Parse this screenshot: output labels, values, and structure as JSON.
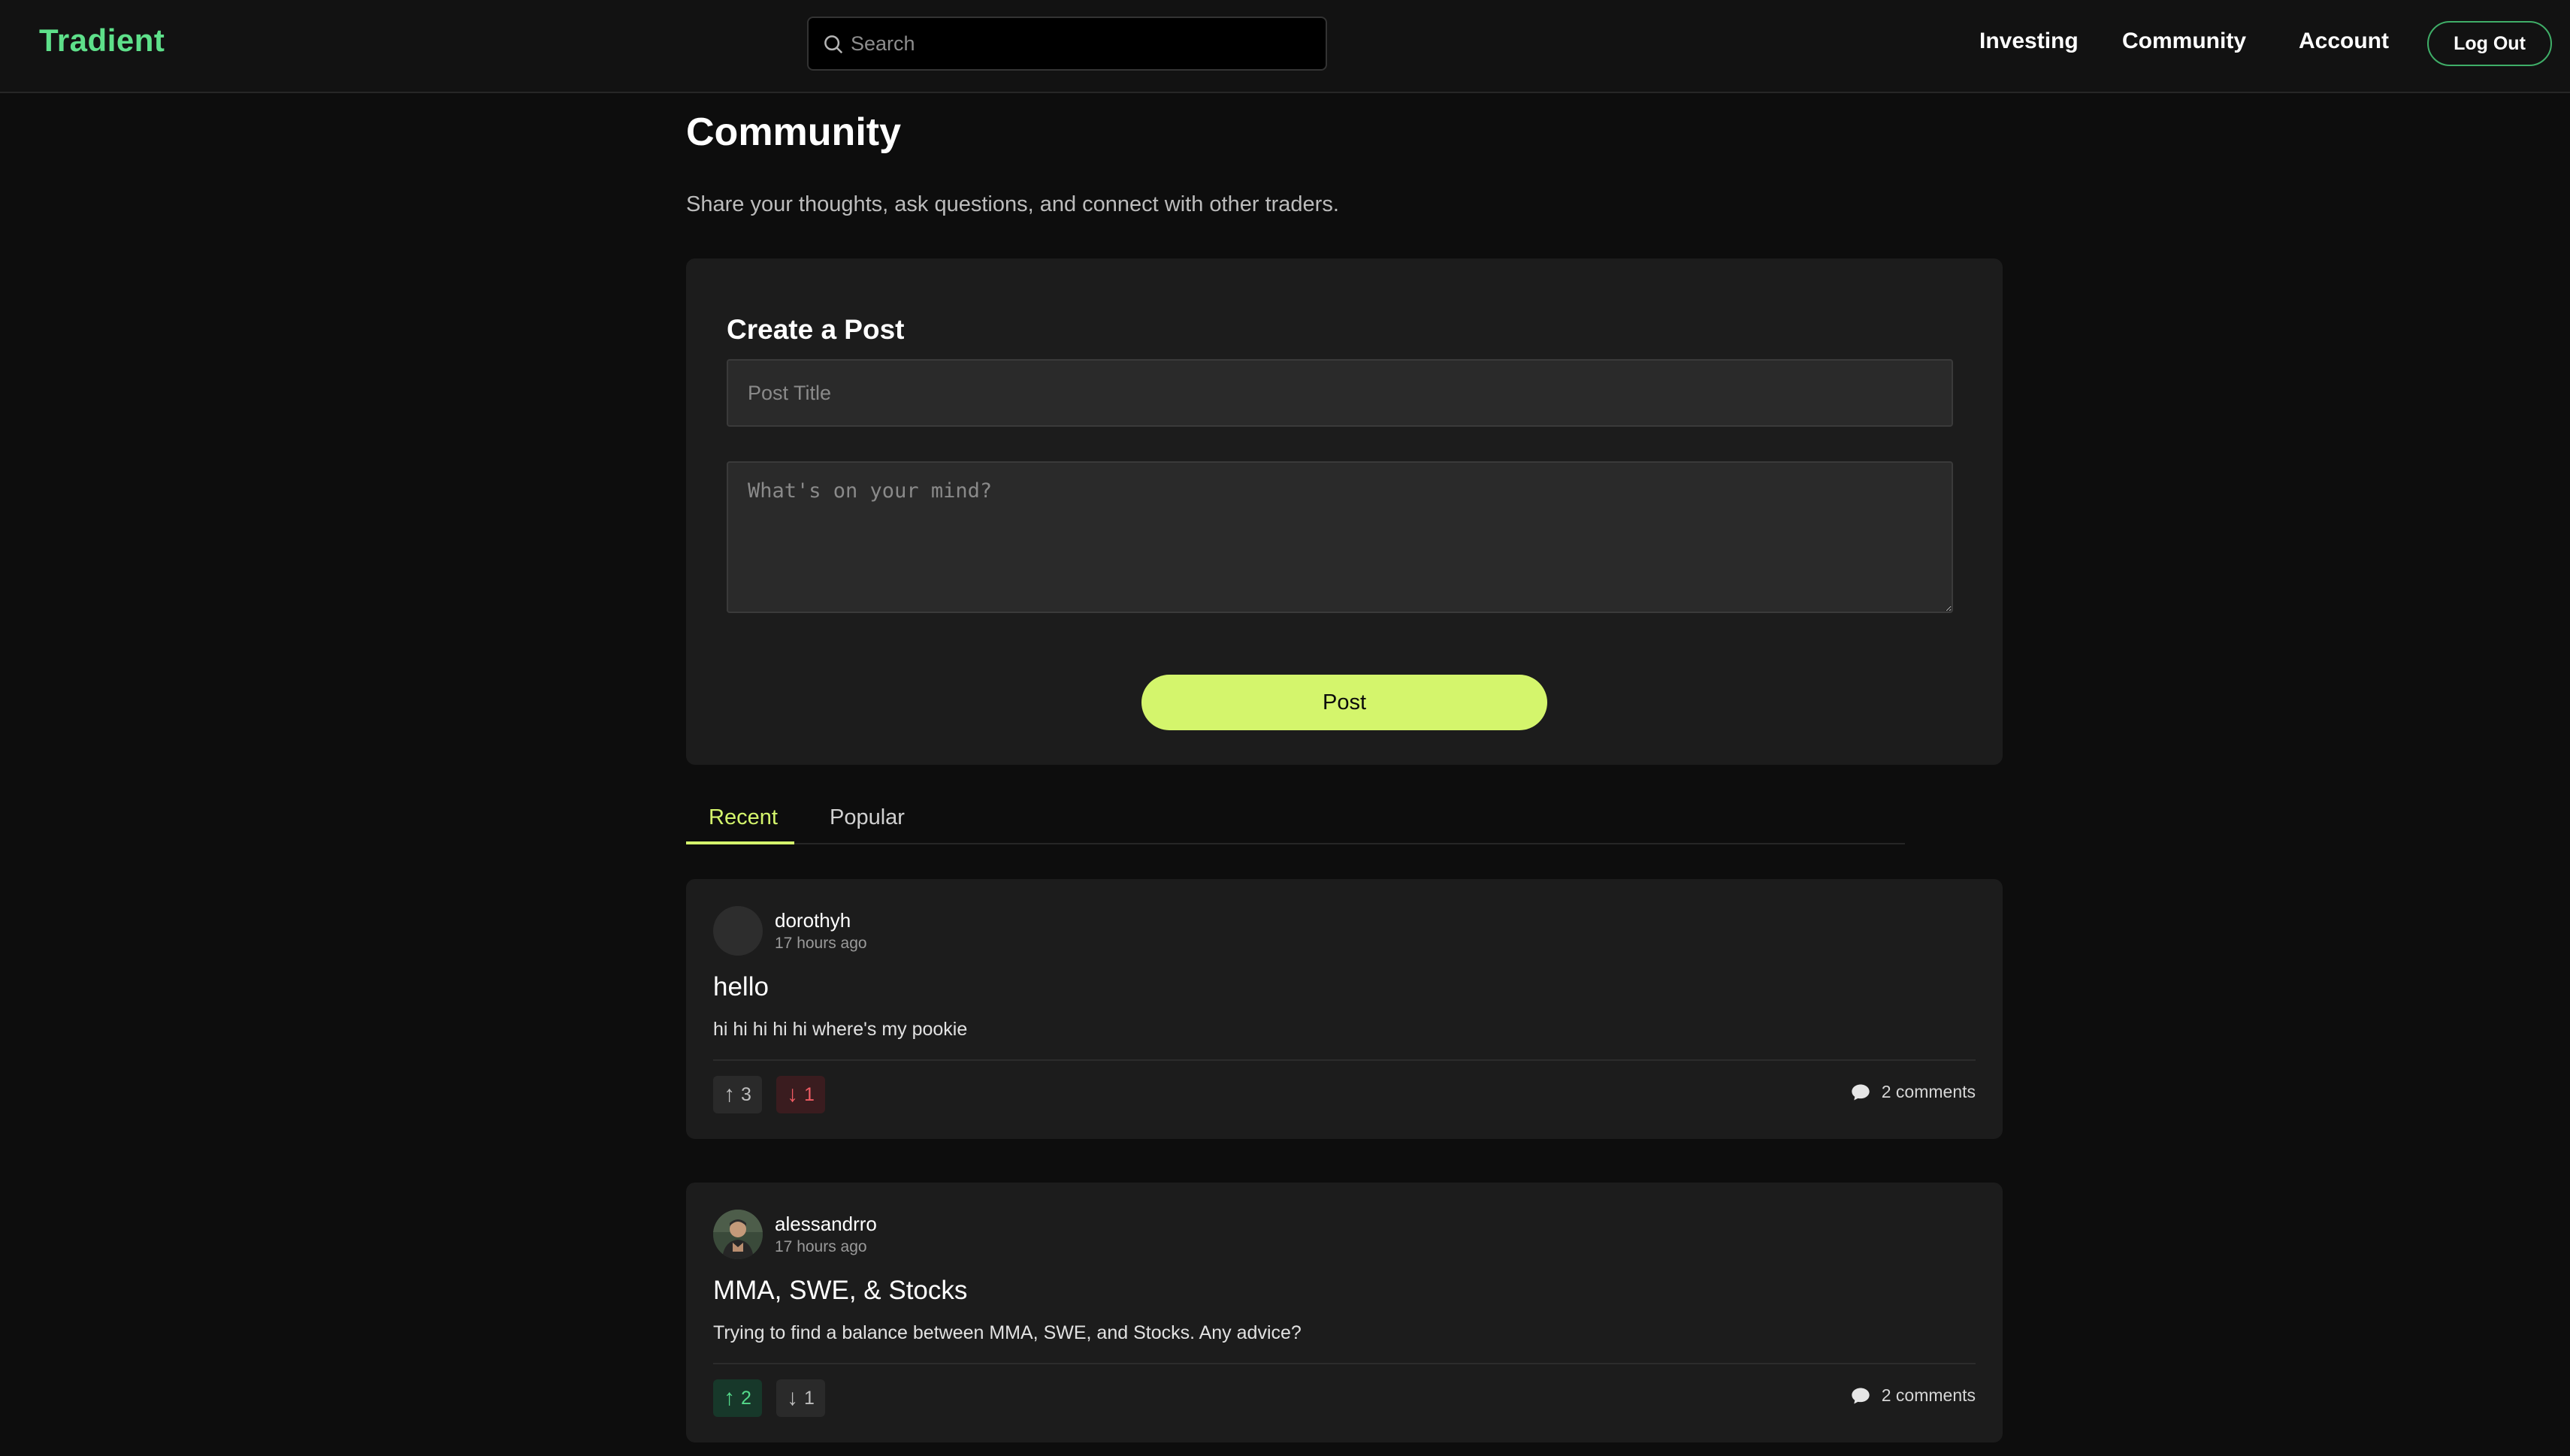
{
  "app": {
    "logo": "Tradient"
  },
  "search": {
    "placeholder": "Search"
  },
  "nav": {
    "links": [
      "Investing",
      "Community",
      "Account"
    ],
    "logout_label": "Log Out"
  },
  "page": {
    "title": "Community",
    "subtitle": "Share your thoughts, ask questions, and connect with other traders."
  },
  "create_post": {
    "heading": "Create a Post",
    "title_placeholder": "Post Title",
    "body_placeholder": "What's on your mind?",
    "submit_label": "Post"
  },
  "tabs": [
    {
      "label": "Recent",
      "active": true
    },
    {
      "label": "Popular",
      "active": false
    }
  ],
  "posts": [
    {
      "username": "dorothyh",
      "time": "17 hours ago",
      "avatar": "placeholder-avatar",
      "title": "hello",
      "body": "hi hi hi hi hi where's my pookie",
      "upvotes": "3",
      "downvotes": "1",
      "user_vote": "down",
      "comments": "2 comments"
    },
    {
      "username": "alessandrro",
      "time": "17 hours ago",
      "avatar": "photo-avatar",
      "title": "MMA, SWE, & Stocks",
      "body": "Trying to find a balance between MMA, SWE, and Stocks. Any advice?",
      "upvotes": "2",
      "downvotes": "1",
      "user_vote": "up",
      "comments": "2 comments"
    }
  ],
  "colors": {
    "brand": "#5ee08a",
    "accent": "#d4f56c",
    "upvote": "#54d98a",
    "downvote": "#ef5b63",
    "background": "#0d0d0d",
    "card": "#1c1c1c"
  }
}
